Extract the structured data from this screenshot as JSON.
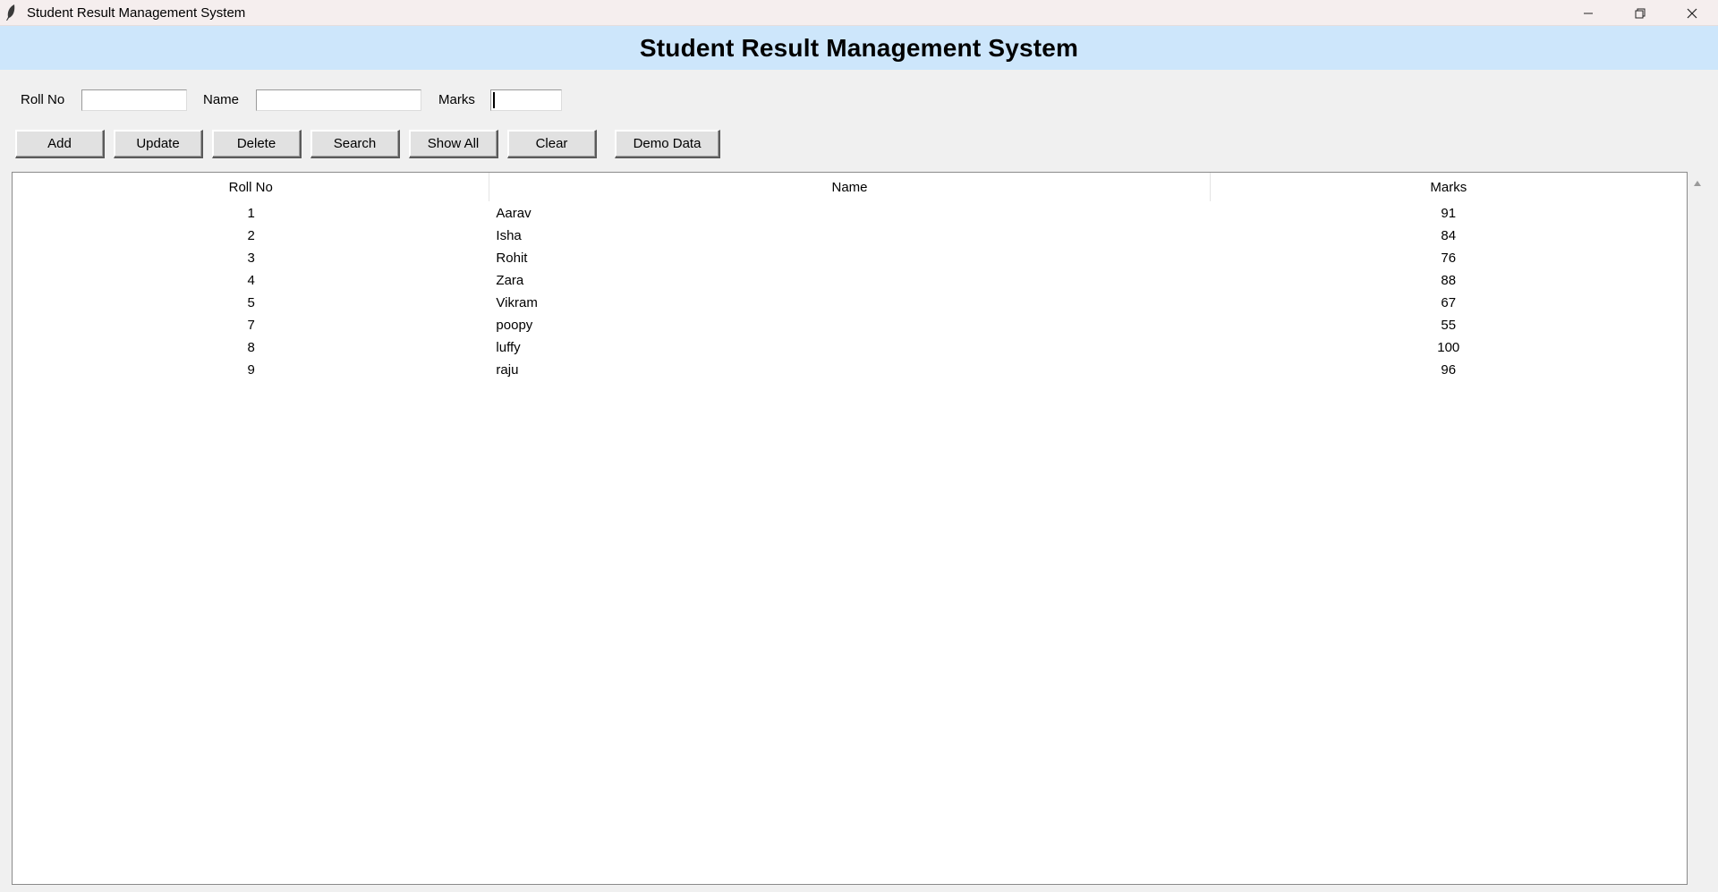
{
  "window": {
    "title": "Student Result Management System"
  },
  "heading": "Student Result Management System",
  "form": {
    "roll_label": "Roll No",
    "roll_value": "",
    "name_label": "Name",
    "name_value": "",
    "marks_label": "Marks",
    "marks_value": ""
  },
  "buttons": {
    "add": "Add",
    "update": "Update",
    "delete": "Delete",
    "search": "Search",
    "show_all": "Show All",
    "clear": "Clear",
    "demo": "Demo Data"
  },
  "table": {
    "columns": [
      "Roll No",
      "Name",
      "Marks"
    ],
    "rows": [
      {
        "roll": "1",
        "name": "Aarav",
        "marks": "91"
      },
      {
        "roll": "2",
        "name": "Isha",
        "marks": "84"
      },
      {
        "roll": "3",
        "name": "Rohit",
        "marks": "76"
      },
      {
        "roll": "4",
        "name": "Zara",
        "marks": "88"
      },
      {
        "roll": "5",
        "name": "Vikram",
        "marks": "67"
      },
      {
        "roll": "7",
        "name": "poopy",
        "marks": "55"
      },
      {
        "roll": "8",
        "name": "luffy",
        "marks": "100"
      },
      {
        "roll": "9",
        "name": "raju",
        "marks": "96"
      }
    ]
  },
  "colors": {
    "heading_band": "#cde6fb",
    "titlebar": "#f5eeee",
    "window_bg": "#f0f0f0"
  }
}
